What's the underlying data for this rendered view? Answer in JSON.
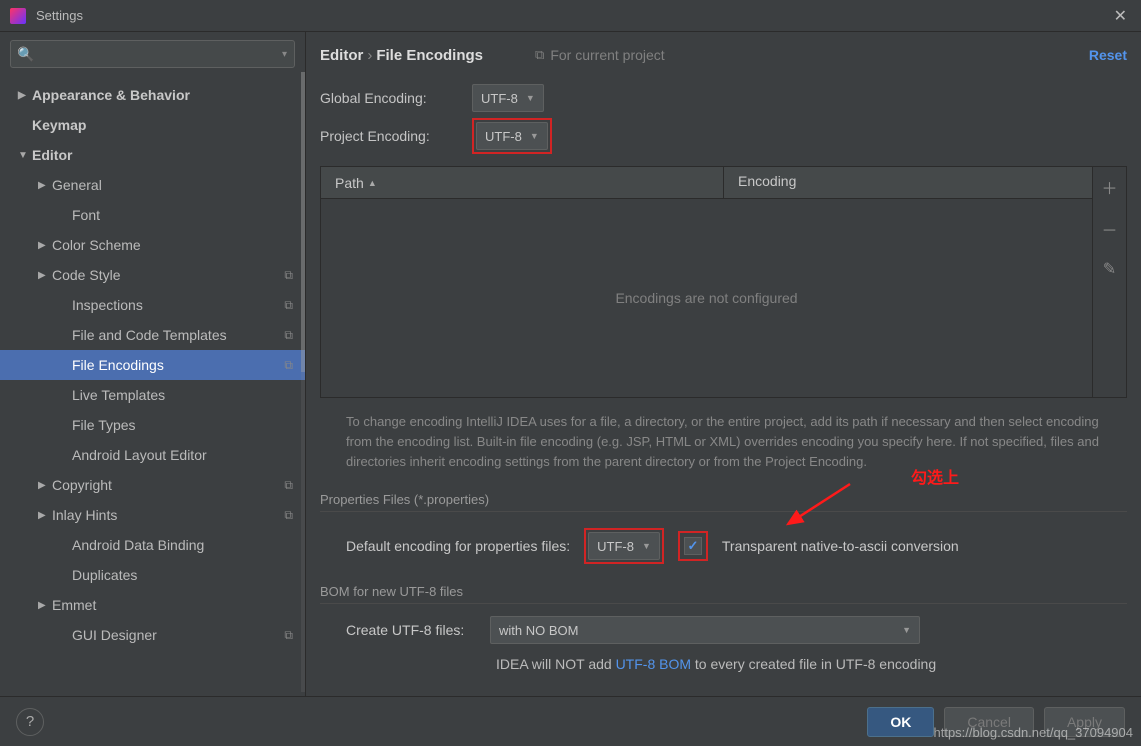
{
  "window": {
    "title": "Settings"
  },
  "search": {
    "placeholder": ""
  },
  "tree": [
    {
      "label": "Appearance & Behavior",
      "lvl": 1,
      "arrow": "right",
      "bold": true
    },
    {
      "label": "Keymap",
      "lvl": 1,
      "arrow": "none",
      "bold": true
    },
    {
      "label": "Editor",
      "lvl": 1,
      "arrow": "down",
      "bold": true
    },
    {
      "label": "General",
      "lvl": 2,
      "arrow": "right"
    },
    {
      "label": "Font",
      "lvl": 3,
      "arrow": "none"
    },
    {
      "label": "Color Scheme",
      "lvl": 2,
      "arrow": "right"
    },
    {
      "label": "Code Style",
      "lvl": 2,
      "arrow": "right",
      "badge": true
    },
    {
      "label": "Inspections",
      "lvl": 3,
      "arrow": "none",
      "badge": true
    },
    {
      "label": "File and Code Templates",
      "lvl": 3,
      "arrow": "none",
      "badge": true
    },
    {
      "label": "File Encodings",
      "lvl": 3,
      "arrow": "none",
      "badge": true,
      "selected": true
    },
    {
      "label": "Live Templates",
      "lvl": 3,
      "arrow": "none"
    },
    {
      "label": "File Types",
      "lvl": 3,
      "arrow": "none"
    },
    {
      "label": "Android Layout Editor",
      "lvl": 3,
      "arrow": "none"
    },
    {
      "label": "Copyright",
      "lvl": 2,
      "arrow": "right",
      "badge": true
    },
    {
      "label": "Inlay Hints",
      "lvl": 2,
      "arrow": "right",
      "badge": true
    },
    {
      "label": "Android Data Binding",
      "lvl": 3,
      "arrow": "none"
    },
    {
      "label": "Duplicates",
      "lvl": 3,
      "arrow": "none"
    },
    {
      "label": "Emmet",
      "lvl": 2,
      "arrow": "right"
    },
    {
      "label": "GUI Designer",
      "lvl": 3,
      "arrow": "none",
      "badge": true
    }
  ],
  "breadcrumb": {
    "part1": "Editor",
    "part2": "File Encodings"
  },
  "project_hint": "For current project",
  "reset": "Reset",
  "global_encoding": {
    "label": "Global Encoding:",
    "value": "UTF-8"
  },
  "project_encoding": {
    "label": "Project Encoding:",
    "value": "UTF-8"
  },
  "table": {
    "col_path": "Path",
    "col_encoding": "Encoding",
    "empty": "Encodings are not configured"
  },
  "description": "To change encoding IntelliJ IDEA uses for a file, a directory, or the entire project, add its path if necessary and then select encoding from the encoding list. Built-in file encoding (e.g. JSP, HTML or XML) overrides encoding you specify here. If not specified, files and directories inherit encoding settings from the parent directory or from the Project Encoding.",
  "properties_section": "Properties Files (*.properties)",
  "properties": {
    "label": "Default encoding for properties files:",
    "value": "UTF-8",
    "checkbox_label": "Transparent native-to-ascii conversion",
    "checked": true
  },
  "annotation": "勾选上",
  "bom_section": "BOM for new UTF-8 files",
  "bom": {
    "label": "Create UTF-8 files:",
    "value": "with NO BOM",
    "note_pre": "IDEA will NOT add ",
    "note_link": "UTF-8 BOM",
    "note_post": " to every created file in UTF-8 encoding"
  },
  "buttons": {
    "ok": "OK",
    "cancel": "Cancel",
    "apply": "Apply"
  },
  "watermark": "https://blog.csdn.net/qq_37094904"
}
